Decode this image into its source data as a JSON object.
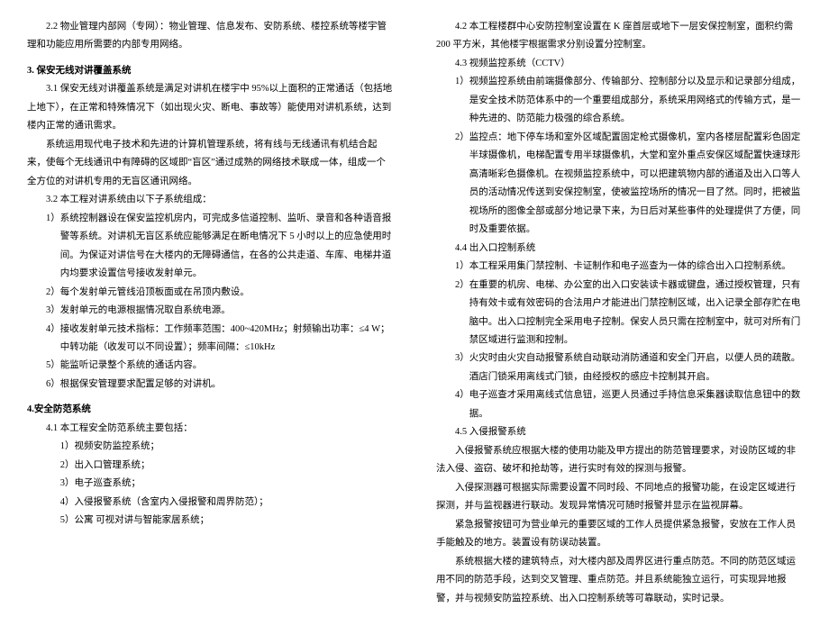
{
  "left": {
    "p1": "2.2 物业管理内部网（专网）：物业管理、信息发布、安防系统、楼控系统等楼宇管理和功能应用所需要的内部专用网络。",
    "h3": "3. 保安无线对讲覆盖系统",
    "p3_1": "3.1 保安无线对讲覆盖系统是满足对讲机在楼宇中 95%以上面积的正常通话（包括地上地下），在正常和特殊情况下（如出现火灾、断电、事故等）能使用对讲机系统，达到楼内正常的通讯需求。",
    "p3_2": "系统运用现代电子技术和先进的计算机管理系统，将有线与无线通讯有机结合起来，使每个无线通讯中有障碍的区域即“盲区”通过成熟的网络技术联成一体，组成一个全方位的对讲机专用的无盲区通讯网络。",
    "p3_3": "3.2 本工程对讲系统由以下子系统组成：",
    "li1": "1）系统控制器设在保安监控机房内，可完成多信道控制、监听、录音和各种语音报警等系统。对讲机无盲区系统应能够满足在断电情况下 5 小时以上的应急使用时间。为保证对讲信号在大楼内的无障碍通信，在各的公共走道、车库、电梯井道内均要求设置信号接收发射单元。",
    "li2": "2）每个发射单元管线沿顶板面或在吊顶内敷设。",
    "li3": "3）发射单元的电源根据情况取自系统电源。",
    "li4": "4）接收发射单元技术指标：工作频率范围：400~420MHz；射频输出功率：≤4 W；中转功能（收发可以不同设置）；频率间隔：≤10kHz",
    "li5": "5）能监听记录整个系统的通话内容。",
    "li6": "6）根据保安管理要求配置足够的对讲机。",
    "h4": "4.安全防范系统",
    "p4_1": "4.1 本工程安全防范系统主要包括：",
    "s4_1": "1）视频安防监控系统；",
    "s4_2": "2）出入口管理系统；",
    "s4_3": "3）电子巡查系统；",
    "s4_4": "4）入侵报警系统（含室内入侵报警和周界防范）；",
    "s4_5": "5）公寓 可视对讲与智能家居系统；"
  },
  "right": {
    "p4_2": "4.2 本工程楼群中心安防控制室设置在 K 座首层或地下一层安保控制室，面积约需 200 平方米，其他楼宇根据需求分别设置分控制室。",
    "p4_3h": "4.3 视频监控系统（CCTV）",
    "r1": "1）视频监控系统由前端摄像部分、传输部分、控制部分以及显示和记录部分组成，是安全技术防范体系中的一个重要组成部分，系统采用网络式的传输方式，是一种先进的、防范能力极强的综合系统。",
    "r2": "2）监控点：地下停车场和室外区域配置固定枪式摄像机，室内各楼层配置彩色固定半球摄像机，电梯配置专用半球摄像机，大堂和室外重点安保区域配置快速球形高清晰彩色摄像机。在视频监控系统中，可以把建筑物内部的通道及出入口等人员的活动情况传送到安保控制室，使被监控场所的情况一目了然。同时，把被监视场所的图像全部或部分地记录下来，为日后对某些事件的处理提供了方便，同时及重要依据。",
    "p4_4h": "4.4 出入口控制系统",
    "r4_1": "1）本工程采用集门禁控制、卡证制作和电子巡查为一体的综合出入口控制系统。",
    "r4_2": "2）在重要的机房、电梯、办公室的出入口安装读卡器或键盘，通过授权管理，只有持有效卡或有效密码的合法用户才能进出门禁控制区域，出入记录全部存贮在电脑中。出入口控制完全采用电子控制。保安人员只需在控制室中，就可对所有门禁区域进行监测和控制。",
    "r4_3": "3）火灾时由火灾自动报警系统自动联动消防通道和安全门开启，以便人员的疏散。酒店门锁采用离线式门锁，由经授权的感应卡控制其开启。",
    "r4_4": "4）电子巡查才采用离线式信息钮，巡更人员通过手持信息采集器读取信息钮中的数据。",
    "p4_5h": "4.5 入侵报警系统",
    "p4_5a": "入侵报警系统应根据大楼的使用功能及甲方提出的防范管理要求，对设防区域的非法入侵、盗窃、破坏和抢劫等，进行实时有效的探测与报警。",
    "p4_5b": "入侵探测器可根据实际需要设置不同时段、不同地点的报警功能，在设定区域进行探测，并与监视器进行联动。发现异常情况可随时报警并显示在监视屏幕。",
    "p4_5c": "紧急报警按钮可为营业单元的重要区域的工作人员提供紧急报警，安放在工作人员手能触及的地方。装置设有防误动装置。",
    "p4_5d": "系统根据大楼的建筑特点，对大楼内部及周界区进行重点防范。不同的防范区域运用不同的防范手段，达到交叉管理、重点防范。并且系统能独立运行，可实现异地报警，并与视频安防监控系统、出入口控制系统等可靠联动，实时记录。"
  }
}
